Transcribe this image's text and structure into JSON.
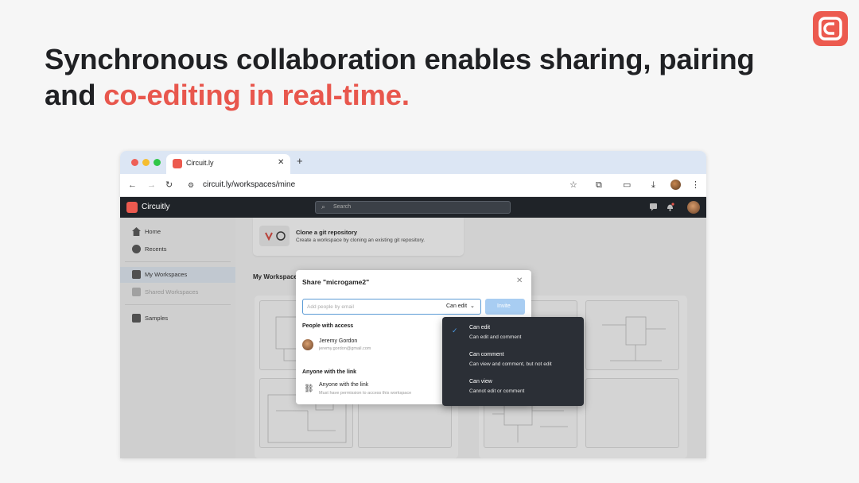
{
  "slide": {
    "headline_part1": "Synchronous collaboration enables sharing, pairing and ",
    "headline_accent": "co-editing in real-time.",
    "accent_color": "#e8574d",
    "logo_icon": "circuitly-logo-icon"
  },
  "browser": {
    "tab_title": "Circuit.ly",
    "tab_close": "✕",
    "new_tab": "+",
    "url": "circuit.ly/workspaces/mine"
  },
  "app": {
    "name": "Circuitly",
    "search_placeholder": "Search",
    "sidebar": {
      "items": [
        {
          "label": "Home",
          "icon": "home-icon"
        },
        {
          "label": "Recents",
          "icon": "clock-icon"
        },
        {
          "label": "My Workspaces",
          "icon": "grid-icon",
          "active": true
        },
        {
          "label": "Shared Workspaces",
          "icon": "shared-grid-icon",
          "disabled": true
        },
        {
          "label": "Samples",
          "icon": "table-icon"
        }
      ]
    },
    "clone": {
      "title": "Clone a git repository",
      "subtitle": "Create a workspace by cloning an existing git repository."
    },
    "workspaces_title": "My Workspace"
  },
  "share_dialog": {
    "title": "Share \"microgame2\"",
    "close": "✕",
    "input_placeholder": "Add people by email",
    "permission": "Can edit",
    "invite_label": "Invite",
    "people_section": "People with access",
    "person": {
      "name": "Jeremy Gordon",
      "email": "jeremy.gordon@gmail.com"
    },
    "link_section": "Anyone with the link",
    "link": {
      "title": "Anyone with the link",
      "subtitle": "Must have permission to access this workspace"
    }
  },
  "permission_dropdown": {
    "options": [
      {
        "title": "Can edit",
        "subtitle": "Can edit and comment",
        "selected": true
      },
      {
        "title": "Can comment",
        "subtitle": "Can view and comment, but not edit",
        "selected": false
      },
      {
        "title": "Can view",
        "subtitle": "Cannot edit or comment",
        "selected": false
      }
    ],
    "check_icon": "✓"
  }
}
